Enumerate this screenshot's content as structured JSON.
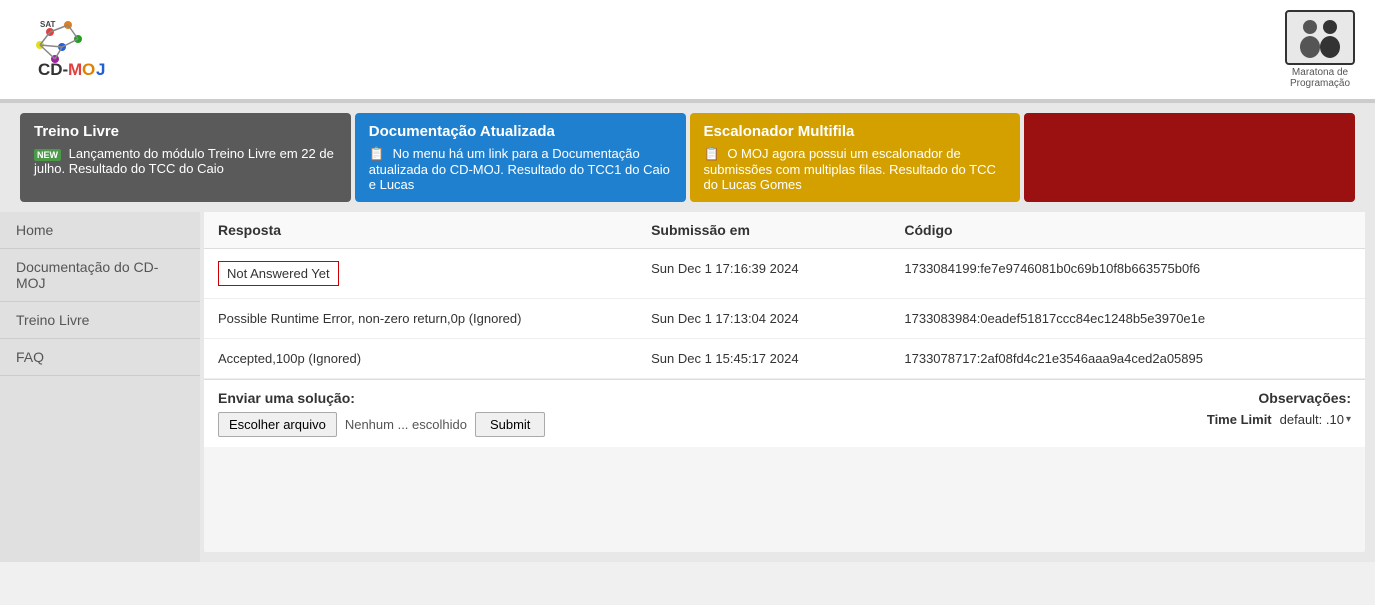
{
  "header": {
    "logo_text": "SAT CD-MOJ",
    "maratona_label": "Maratona de\nProgramação"
  },
  "banners": [
    {
      "id": "treino-livre",
      "title": "Treino Livre",
      "badge": "NEW",
      "text": "Lançamento do módulo Treino Livre em 22 de julho. Resultado do TCC do Caio",
      "color_class": "banner-gray"
    },
    {
      "id": "documentacao",
      "title": "Documentação Atualizada",
      "icon": "📋",
      "text": "No menu há um link para a Documentação atualizada do CD-MOJ. Resultado do TCC1 do Caio e Lucas",
      "color_class": "banner-blue"
    },
    {
      "id": "escalonador",
      "title": "Escalonador Multifila",
      "icon": "📋",
      "text": "O MOJ agora possui um escalonador de submissões com multiplas filas. Resultado do TCC do Lucas Gomes",
      "color_class": "banner-yellow"
    },
    {
      "id": "red-banner",
      "title": "",
      "text": "",
      "color_class": "banner-red"
    }
  ],
  "sidebar": {
    "items": [
      {
        "label": "Home",
        "id": "home"
      },
      {
        "label": "Documentação do CD-MOJ",
        "id": "documentacao"
      },
      {
        "label": "Treino Livre",
        "id": "treino-livre"
      },
      {
        "label": "FAQ",
        "id": "faq"
      }
    ]
  },
  "table": {
    "columns": [
      "Resposta",
      "Submissão em",
      "Código"
    ],
    "rows": [
      {
        "resposta": "Not Answered Yet",
        "resposta_type": "badge",
        "submissao": "Sun Dec 1 17:16:39 2024",
        "codigo": "1733084199:fe7e9746081b0c69b10f8b663575b0f6"
      },
      {
        "resposta": "Possible Runtime Error, non-zero return,0p (Ignored)",
        "resposta_type": "text",
        "submissao": "Sun Dec 1 17:13:04 2024",
        "codigo": "1733083984:0eadef51817ccc84ec1248b5e3970e1e"
      },
      {
        "resposta": "Accepted,100p (Ignored)",
        "resposta_type": "text",
        "submissao": "Sun Dec 1 15:45:17 2024",
        "codigo": "1733078717:2af08fd4c21e3546aaa9a4ced2a05895"
      }
    ]
  },
  "bottom": {
    "enviar_label": "Enviar uma solução:",
    "btn_file_label": "Escolher arquivo",
    "file_name": "Nenhum ... escolhido",
    "btn_submit_label": "Submit",
    "observacoes_label": "Observações:",
    "time_limit_key": "Time Limit",
    "time_limit_value": "default: .10"
  }
}
